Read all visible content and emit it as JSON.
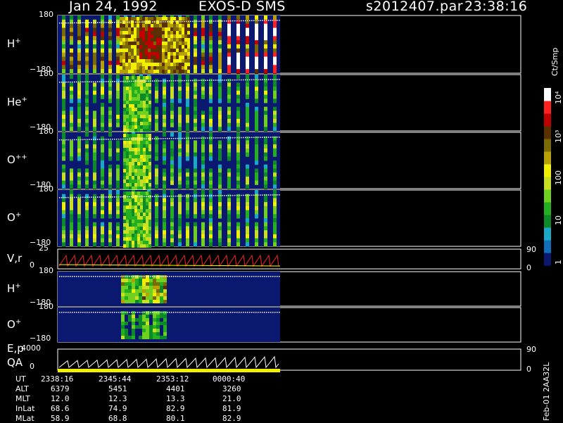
{
  "header": {
    "date": "Jan 24, 1992",
    "instrument": "EXOS-D SMS",
    "file": "s2012407.par",
    "time": "23:38:16"
  },
  "colors": {
    "background": "#000000",
    "frame": "#ffffff",
    "spectral_scale": [
      "#0a1870",
      "#0f6fb8",
      "#1aa8c8",
      "#0c8a2a",
      "#22b020",
      "#6fd020",
      "#c8e020",
      "#f0f000",
      "#b8a000",
      "#7a6a00",
      "#5a3000",
      "#c00000",
      "#ff2020",
      "#ffffff"
    ]
  },
  "panels": [
    {
      "name": "H+",
      "ion": "H",
      "charge": "+",
      "ytop": "180",
      "ybottom": "−180"
    },
    {
      "name": "He+",
      "ion": "He",
      "charge": "+",
      "ytop": "180",
      "ybottom": "−180"
    },
    {
      "name": "O++",
      "ion": "O",
      "charge": "++",
      "ytop": "180",
      "ybottom": "−180"
    },
    {
      "name": "O+",
      "ion": "O",
      "charge": "+",
      "ytop": "180",
      "ybottom": "−180"
    },
    {
      "name": "V,r",
      "ion": "V,r",
      "charge": "",
      "ytop": "25",
      "ybottom": "0",
      "right_top": "90",
      "right_bottom": "0"
    },
    {
      "name": "H+ (2)",
      "ion": "H",
      "charge": "+",
      "ytop": "180",
      "ybottom": "−180"
    },
    {
      "name": "O+ (2)",
      "ion": "O",
      "charge": "+",
      "ytop": "180",
      "ybottom": "−180"
    },
    {
      "name": "E,p QA",
      "ion": "E,p",
      "ion2": "QA",
      "charge": "",
      "ytop": "4000",
      "ybottom": "0",
      "right_top": "90",
      "right_bottom": "0"
    }
  ],
  "colorbar": {
    "unit": "Ct/Smp",
    "ticks": [
      "10⁴",
      "10³",
      "100",
      "10",
      "1"
    ]
  },
  "ephemeris": {
    "rows": [
      {
        "label": "UT",
        "values": [
          "2338:16",
          "2345:44",
          "2353:12",
          "0000:40"
        ]
      },
      {
        "label": "ALT",
        "values": [
          "6379",
          "5451",
          "4401",
          "3260"
        ]
      },
      {
        "label": "MLT",
        "values": [
          "12.0",
          "12.3",
          "13.3",
          "21.0"
        ]
      },
      {
        "label": "InLat",
        "values": [
          "68.6",
          "74.9",
          "82.9",
          "81.9"
        ]
      },
      {
        "label": "MLat",
        "values": [
          "58.9",
          "68.8",
          "80.1",
          "82.9"
        ]
      }
    ]
  },
  "footer_id": "Feb-01 2AA32L",
  "chart_data": {
    "type": "heatmap",
    "title": "Jan 24, 1992   EXOS-D SMS",
    "xlabel": "UT",
    "x_ticks": [
      "2338:16",
      "2345:44",
      "2353:12",
      "0000:40"
    ],
    "series": [
      {
        "name": "H+",
        "ylim": [
          -180,
          180
        ]
      },
      {
        "name": "He+",
        "ylim": [
          -180,
          180
        ]
      },
      {
        "name": "O++",
        "ylim": [
          -180,
          180
        ]
      },
      {
        "name": "O+",
        "ylim": [
          -180,
          180
        ]
      },
      {
        "name": "V,r",
        "ylim": [
          0,
          25
        ]
      },
      {
        "name": "H+",
        "ylim": [
          -180,
          180
        ]
      },
      {
        "name": "O+",
        "ylim": [
          -180,
          180
        ]
      },
      {
        "name": "E,p",
        "ylim": [
          0,
          4000
        ]
      }
    ],
    "colorbar": {
      "label": "Ct/Smp",
      "scale": "log",
      "range": [
        1,
        10000
      ]
    }
  }
}
